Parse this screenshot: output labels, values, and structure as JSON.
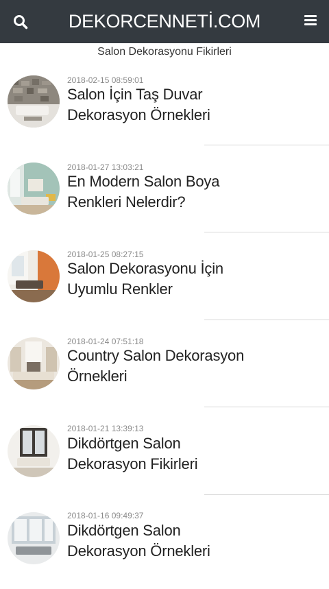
{
  "header": {
    "brand": "DEKORCENNETİ.COM",
    "search_icon": "search-icon",
    "menu_icon": "hamburger-menu-icon",
    "background": "#343a40"
  },
  "page": {
    "title": "Salon Dekorasyonu Fikirleri"
  },
  "posts": [
    {
      "date": "2018-02-15 08:59:01",
      "title_line1": "Salon İçin Taş Duvar",
      "title_line2": "Dekorasyon Örnekleri"
    },
    {
      "date": "2018-01-27 13:03:21",
      "title_line1": "En Modern Salon Boya",
      "title_line2": "Renkleri Nelerdir?"
    },
    {
      "date": "2018-01-25 08:27:15",
      "title_line1": "Salon Dekorasyonu İçin",
      "title_line2": "Uyumlu Renkler"
    },
    {
      "date": "2018-01-24 07:51:18",
      "title_line1": "Country Salon Dekorasyon",
      "title_line2": "Örnekleri"
    },
    {
      "date": "2018-01-21 13:39:13",
      "title_line1": "Dikdörtgen Salon",
      "title_line2": "Dekorasyon Fikirleri"
    },
    {
      "date": "2018-01-16 09:49:37",
      "title_line1": "Dikdörtgen Salon",
      "title_line2": "Dekorasyon Örnekleri"
    }
  ]
}
